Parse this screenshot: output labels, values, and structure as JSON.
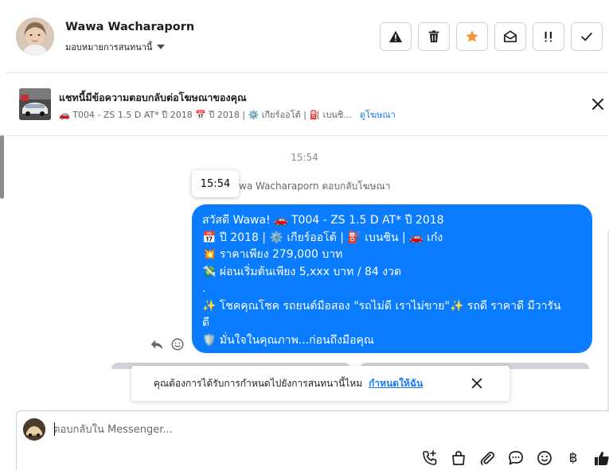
{
  "contact": {
    "name": "Wawa Wacharaporn",
    "assign_label": "มอบหมายการสนทนานี้"
  },
  "ad_banner": {
    "title": "แชทนี้มีข้อความตอบกลับต่อโฆษณาของคุณ",
    "subtitle": "🚗 T004 - ZS 1.5 D AT* ปี 2018 📅 ปี 2018 | ⚙️ เกียร์ออโต้ | ⛽ เบนซิ...",
    "link": "ดูโฆษณา"
  },
  "chat": {
    "timestamp": "15:54",
    "tooltip_time": "15:54",
    "replied_note": "wa Wacharaporn ตอบกลับโฆษณา",
    "message_lines": [
      "สวัสดี Wawa! 🚗 T004 - ZS 1.5 D AT* ปี 2018",
      "📅 ปี 2018 | ⚙️ เกียร์ออโต้ | ⛽ เบนซิน | 🚗 เก๋ง",
      "💥 ราคาเพียง 279,000 บาท",
      "💸 ผ่อนเริ่มต้นเพียง 5,xxx บาท / 84 งวด",
      ".",
      "✨ โชคคุณโชค รถยนต์มือสอง \"รถไม่ดี เราไม่ขาย\"✨ รถดี ราคาดี มีวารัน",
      "ดี",
      "🛡️ มั่นใจในคุณภาพ...ก่อนถึงมือคุณ"
    ]
  },
  "reminder": {
    "text": "คุณต้องการได้รับการกำหนดไปยังการสนทนานี้ไหม",
    "link": "กำหนดให้ฉัน"
  },
  "composer": {
    "placeholder": "ตอบกลับใน Messenger..."
  },
  "icons": {
    "alert": "alert-icon",
    "trash": "trash-icon",
    "star": "star-icon",
    "envelope": "envelope-open-icon",
    "priority": "priority-icon",
    "check": "check-icon",
    "close": "close-icon",
    "reply": "reply-icon",
    "emoji": "emoji-icon",
    "call": "call-add-icon",
    "bag": "shopping-bag-icon",
    "attach": "paperclip-icon",
    "chat": "chat-bubble-icon",
    "baht": "baht-icon",
    "like": "thumbs-up-icon"
  },
  "colors": {
    "bubble": "#0a7cff",
    "link": "#1877f2",
    "star": "#f7923a"
  }
}
